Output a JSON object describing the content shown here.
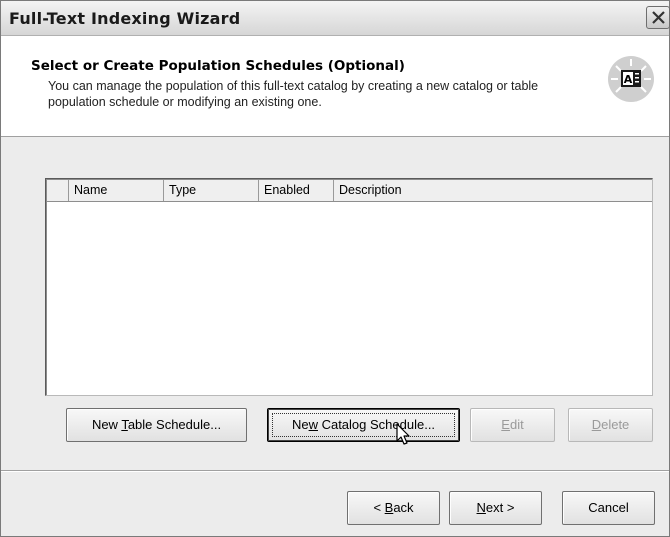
{
  "window": {
    "title": "Full-Text Indexing Wizard"
  },
  "header": {
    "title": "Select or Create Population Schedules (Optional)",
    "description": "You can manage the population of this full-text catalog by creating a new catalog or table population schedule or modifying an existing one.",
    "icon": "wizard-document-icon"
  },
  "schedule_list": {
    "columns": [
      "Name",
      "Type",
      "Enabled",
      "Description"
    ],
    "rows": []
  },
  "schedule_buttons": {
    "new_table": {
      "before": "New ",
      "mnemonic": "T",
      "after": "able Schedule..."
    },
    "new_catalog": {
      "before": "Ne",
      "mnemonic": "w",
      "after": " Catalog Schedule..."
    },
    "edit": {
      "before": "",
      "mnemonic": "E",
      "after": "dit"
    },
    "delete": {
      "before": "",
      "mnemonic": "D",
      "after": "elete"
    }
  },
  "nav_buttons": {
    "back": {
      "before": "< ",
      "mnemonic": "B",
      "after": "ack"
    },
    "next": {
      "before": "",
      "mnemonic": "N",
      "after": "ext >"
    },
    "cancel": "Cancel"
  },
  "colors": {
    "window_bg": "#ececec",
    "header_bg": "#ffffff",
    "disabled_text": "#9a9a9a"
  }
}
